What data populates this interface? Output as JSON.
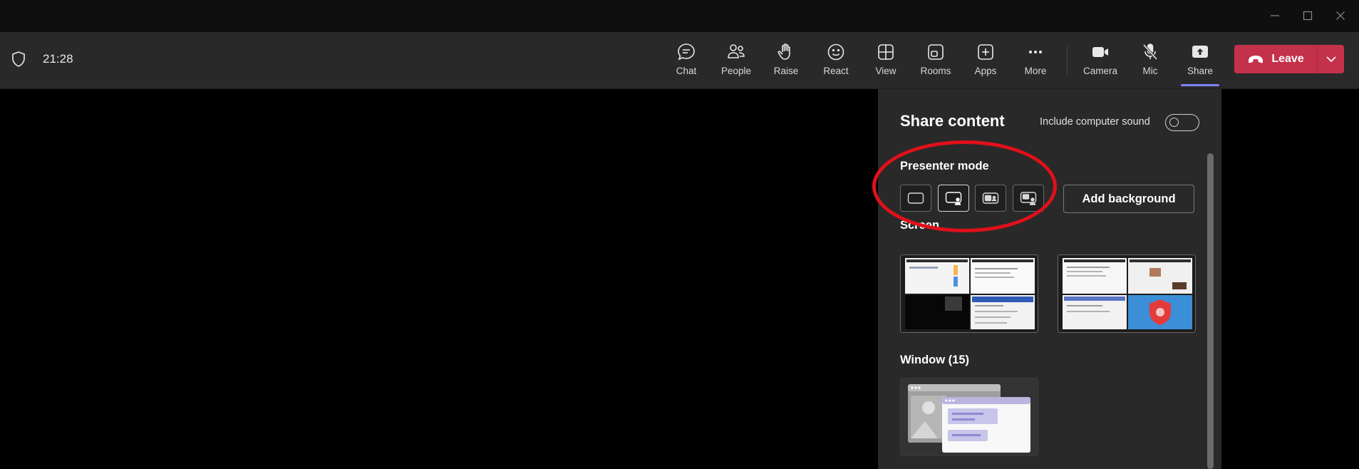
{
  "titlebar": {
    "controls": [
      {
        "name": "minimize-icon"
      },
      {
        "name": "maximize-icon"
      },
      {
        "name": "close-icon"
      }
    ]
  },
  "toolbar": {
    "time": "21:28",
    "buttons": [
      {
        "label": "Chat",
        "icon": "chat-icon"
      },
      {
        "label": "People",
        "icon": "people-icon"
      },
      {
        "label": "Raise",
        "icon": "raise-hand-icon"
      },
      {
        "label": "React",
        "icon": "smile-icon"
      },
      {
        "label": "View",
        "icon": "grid-icon"
      },
      {
        "label": "Rooms",
        "icon": "rooms-icon"
      },
      {
        "label": "Apps",
        "icon": "add-app-icon"
      },
      {
        "label": "More",
        "icon": "more-icon"
      },
      {
        "label": "Camera",
        "icon": "camera-icon"
      },
      {
        "label": "Mic",
        "icon": "mic-off-icon"
      },
      {
        "label": "Share",
        "icon": "share-icon",
        "active": true
      }
    ],
    "leave_label": "Leave",
    "leave_color": "#c4314b",
    "accent_color": "#7f85f5"
  },
  "share_panel": {
    "title": "Share content",
    "include_sound_label": "Include computer sound",
    "include_sound_on": false,
    "presenter_mode_label": "Presenter mode",
    "presenter_modes": [
      "content-only",
      "standout",
      "side-by-side",
      "reporter"
    ],
    "selected_mode": "standout",
    "add_background_label": "Add background",
    "screen_label": "Screen",
    "window_label": "Window (15)"
  }
}
